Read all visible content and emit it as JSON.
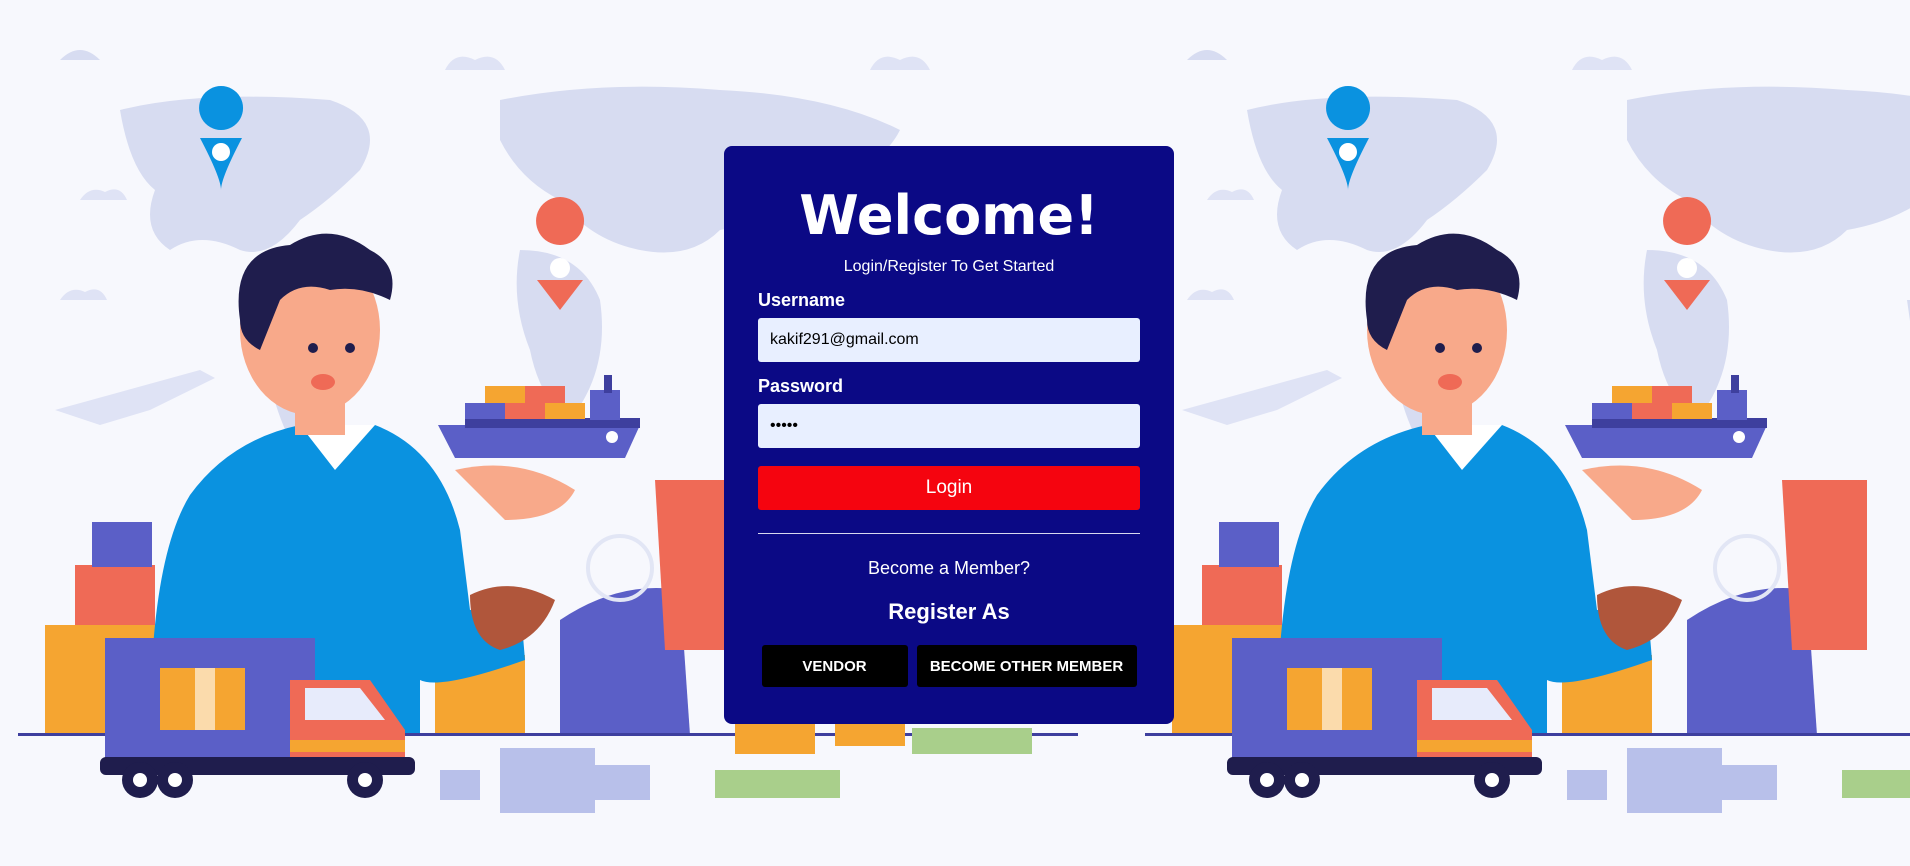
{
  "login_card": {
    "title": "Welcome!",
    "subtitle": "Login/Register To Get Started",
    "username_label": "Username",
    "username_value": "kakif291@gmail.com",
    "password_label": "Password",
    "password_value": "•••••",
    "login_label": "Login",
    "member_prompt": "Become a Member?",
    "register_heading": "Register As",
    "vendor_label": "VENDOR",
    "other_member_label": "BECOME OTHER MEMBER"
  },
  "colors": {
    "card_background": "#0b0985",
    "login_button": "#f5040f",
    "input_background": "#e8efff",
    "role_button": "#000000"
  },
  "background": {
    "illustration": "logistics-handshake-illustration"
  }
}
